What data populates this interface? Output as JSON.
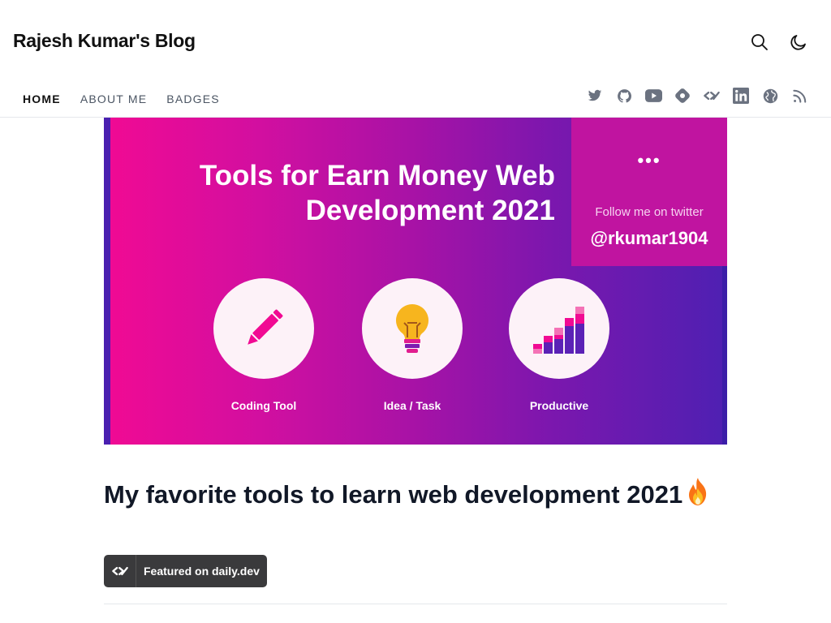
{
  "site": {
    "title": "Rajesh Kumar's Blog"
  },
  "header": {
    "search_icon": "search-icon",
    "theme_icon": "moon-icon"
  },
  "nav": {
    "items": [
      {
        "label": "HOME",
        "active": true
      },
      {
        "label": "ABOUT ME",
        "active": false
      },
      {
        "label": "BADGES",
        "active": false
      }
    ]
  },
  "social": [
    "twitter-icon",
    "github-icon",
    "youtube-icon",
    "hashnode-icon",
    "dailydev-icon",
    "linkedin-icon",
    "globe-icon",
    "rss-icon"
  ],
  "cover": {
    "title_line1": "Tools for Earn Money Web",
    "title_line2": "Development 2021",
    "dots": "•••",
    "follow": "Follow me on twitter",
    "handle": "@rkumar1904",
    "labels": [
      "Coding Tool",
      "Idea / Task",
      "Productive"
    ],
    "gradient": [
      "#f10a93",
      "#4e20b2"
    ]
  },
  "post": {
    "title": "My favorite tools to learn web development 2021"
  },
  "badge": {
    "label": "Featured on daily.dev"
  },
  "colors": {
    "accent": "#f10a93",
    "text": "#111827",
    "muted": "#4b5563"
  }
}
